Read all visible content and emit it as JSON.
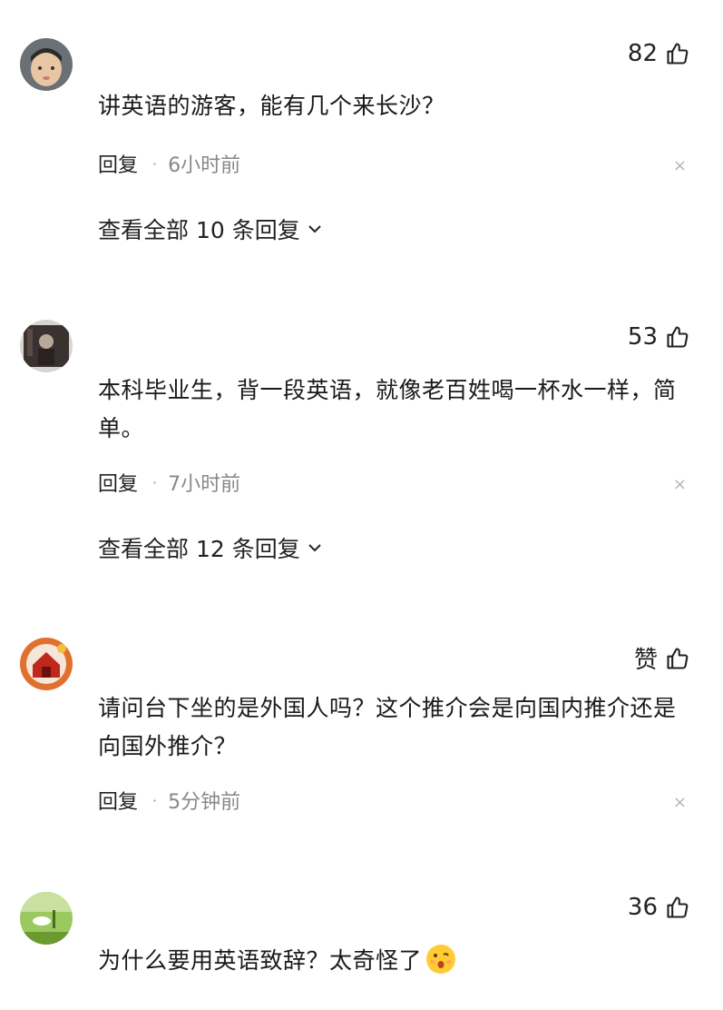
{
  "comments": [
    {
      "likes": "82",
      "text": "讲英语的游客，能有几个来长沙？",
      "reply_label": "回复",
      "dot": "·",
      "time": "6小时前",
      "view_all": "查看全部 10 条回复",
      "close": "×",
      "avatar_icon": "child-portrait-avatar"
    },
    {
      "likes": "53",
      "text": "本科毕业生，背一段英语，就像老百姓喝一杯水一样，简单。",
      "reply_label": "回复",
      "dot": "·",
      "time": "7小时前",
      "view_all": "查看全部 12 条回复",
      "close": "×",
      "avatar_icon": "dark-photo-avatar"
    },
    {
      "likes": "赞",
      "text": "请问台下坐的是外国人吗？这个推介会是向国内推介还是向国外推介？",
      "reply_label": "回复",
      "dot": "·",
      "time": "5分钟前",
      "close": "×",
      "avatar_icon": "red-house-avatar"
    },
    {
      "likes": "36",
      "text": "为什么要用英语致辞？太奇怪了",
      "avatar_icon": "green-field-avatar",
      "emoji": "surprised-face-emoji"
    }
  ],
  "colors": {
    "text": "#1a1a1a",
    "meta_time": "#888888",
    "close": "#b5b5b5",
    "background": "#ffffff"
  }
}
